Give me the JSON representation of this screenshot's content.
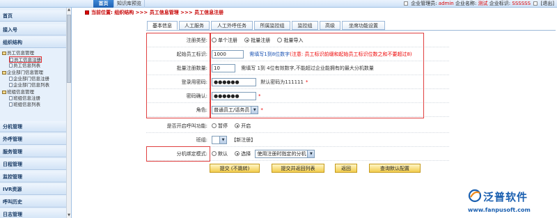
{
  "topbar": {
    "tabs": [
      "首页",
      "知识库预览"
    ],
    "right": {
      "admin_label": "企业管理员:",
      "admin_value": "admin",
      "company_label": "企业名称:",
      "company_value": "测试",
      "id_label": "企业标识:",
      "id_value": "SSSSSS",
      "logout": "[退出]"
    }
  },
  "sidebar": {
    "menus_top": [
      "首页",
      "接入号",
      "组织结构"
    ],
    "tree": [
      {
        "text": "员工信息管理",
        "level": 0
      },
      {
        "text": "员工信息注册",
        "level": 1,
        "selected": true
      },
      {
        "text": "员工信息列表",
        "level": 1
      },
      {
        "text": "企业部门信息管理",
        "level": 0
      },
      {
        "text": "企业部门信息注册",
        "level": 1
      },
      {
        "text": "企业部门信息列表",
        "level": 1
      },
      {
        "text": "班组信息管理",
        "level": 0
      },
      {
        "text": "班组信息注册",
        "level": 1
      },
      {
        "text": "班组信息列表",
        "level": 1
      }
    ],
    "menus_bottom": [
      "分机管理",
      "外呼管理",
      "服务管理",
      "日程管理",
      "监控管理",
      "IVR资源",
      "呼叫历史",
      "日志管理"
    ]
  },
  "breadcrumb": "当前位置: 组织结构 >>> 员工信息管理 >>> 员工信息注册",
  "tabs": [
    "基本信息",
    "人工服务",
    "人工外呼任务",
    "所属监控组",
    "监控组",
    "高级",
    "坐席功能设置"
  ],
  "form": {
    "reg_type": {
      "label": "注册类型:",
      "options": [
        "单个注册",
        "批量注册",
        "批量导入"
      ],
      "selected": 1
    },
    "start_id": {
      "label": "起始员工标识:",
      "value": "1000",
      "hint_blue": "需填写1到8位数字",
      "hint_red": "(注意: 员工标识前缀和起始员工标识位数之和不要超过8)"
    },
    "batch_count": {
      "label": "批量注册数量:",
      "value": "10",
      "hint": "需填写 1到 4位有效数字,不能超过企业能拥有的最大分机数量"
    },
    "password": {
      "label": "登录用密码:",
      "value": "●●●●●●",
      "hint": "默认密码为111111"
    },
    "password_confirm": {
      "label": "密码确认:",
      "value": "●●●●●●"
    },
    "role": {
      "label": "角色:",
      "value": "普通员工/话务员"
    },
    "callout": {
      "label": "是否开启呼叫功能:",
      "options": [
        "暂停",
        "开启"
      ],
      "selected": 1
    },
    "group": {
      "label": "班组:",
      "value": "",
      "link": "【新注册】"
    },
    "ext_bind": {
      "label": "分机绑定模式:",
      "options": [
        "默认",
        "选择"
      ],
      "selected": 1,
      "select_value": "使用注册时指定的分机"
    },
    "star": "*"
  },
  "buttons": [
    "提交 (不跳转)",
    "提交并返回列表",
    "返回",
    "查询默认配置"
  ],
  "logo": {
    "name": "泛普软件",
    "url": "www.fanpusoft.com"
  }
}
